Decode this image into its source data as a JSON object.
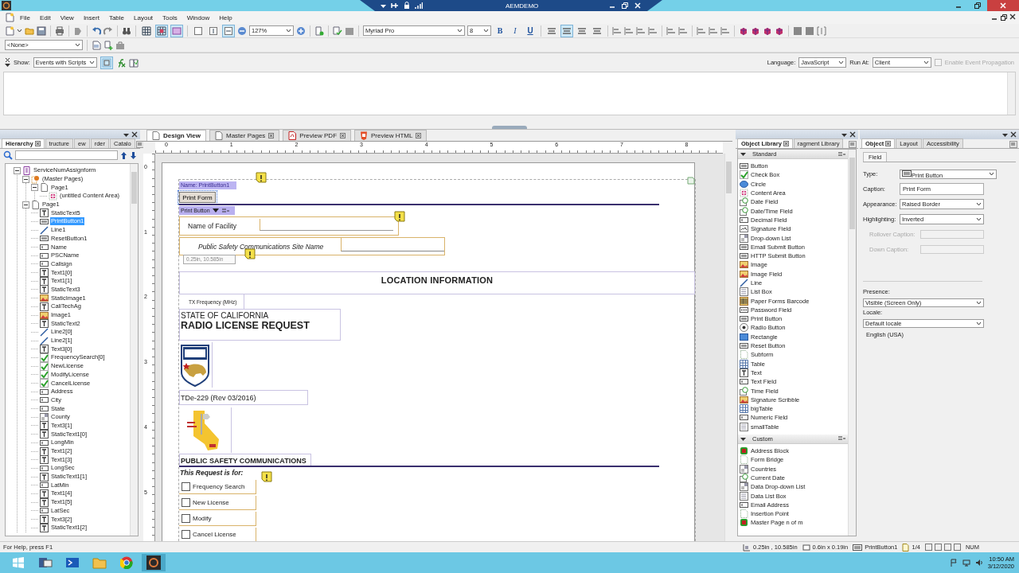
{
  "title_bar": {
    "session_title": "AEMDEMO"
  },
  "menu": [
    "File",
    "Edit",
    "View",
    "Insert",
    "Table",
    "Layout",
    "Tools",
    "Window",
    "Help"
  ],
  "toolbar": {
    "zoom": "127%",
    "font": "Myriad Pro",
    "font_size": "8",
    "view_toggles": [
      {
        "selected": false
      },
      {
        "selected": true
      },
      {
        "selected": true
      }
    ],
    "fit_toggles": [
      {
        "selected": false
      },
      {
        "selected": false
      },
      {
        "selected": true
      }
    ],
    "format": [
      {
        "label": "B",
        "selected": false
      },
      {
        "label": "I",
        "selected": false
      },
      {
        "label": "U",
        "selected": false
      }
    ],
    "align": [
      {
        "selected": false
      },
      {
        "selected": true
      },
      {
        "selected": false
      },
      {
        "selected": false
      }
    ]
  },
  "style_bar": {
    "style": "<None>"
  },
  "script_bar": {
    "show_label": "Show:",
    "show": "Events with Scripts",
    "language_label": "Language:",
    "language": "JavaScript",
    "run_at_label": "Run At:",
    "run_at": "Client",
    "propagation": {
      "label": "Enable Event Propagation",
      "checked": false,
      "disabled": true
    }
  },
  "hierarchy": {
    "tabs": [
      {
        "label": "Hierarchy",
        "selected": true
      },
      {
        "label": "tructure",
        "selected": false
      },
      {
        "label": "ew",
        "selected": false
      },
      {
        "label": "rder",
        "selected": false
      },
      {
        "label": "Catalo",
        "selected": false
      }
    ],
    "tree": [
      {
        "label": "ServiceNumAssignform",
        "kind": "form",
        "selected": false,
        "expanded": true,
        "children": [
          {
            "label": "(Master Pages)",
            "kind": "master",
            "selected": false,
            "expanded": true,
            "children": [
              {
                "label": "Page1",
                "kind": "page",
                "selected": false,
                "expanded": true,
                "children": [
                  {
                    "label": "(untitled Content Area)",
                    "kind": "area",
                    "selected": false
                  }
                ]
              }
            ]
          },
          {
            "label": "Page1",
            "kind": "page",
            "selected": false,
            "expanded": true,
            "children": [
              {
                "label": "StaticText5",
                "kind": "text",
                "selected": false
              },
              {
                "label": "PrintButton1",
                "kind": "button",
                "selected": true
              },
              {
                "label": "Line1",
                "kind": "line",
                "selected": false
              },
              {
                "label": "ResetButton1",
                "kind": "button",
                "selected": false
              },
              {
                "label": "Name",
                "kind": "field",
                "selected": false
              },
              {
                "label": "PSCName",
                "kind": "field",
                "selected": false
              },
              {
                "label": "Callsign",
                "kind": "field",
                "selected": false
              },
              {
                "label": "Text1[0]",
                "kind": "text",
                "selected": false
              },
              {
                "label": "Text1[1]",
                "kind": "text",
                "selected": false
              },
              {
                "label": "StaticText3",
                "kind": "text",
                "selected": false
              },
              {
                "label": "StaticImage1",
                "kind": "image",
                "selected": false
              },
              {
                "label": "CaliTechAg",
                "kind": "text",
                "selected": false
              },
              {
                "label": "Image1",
                "kind": "image",
                "selected": false
              },
              {
                "label": "StaticText2",
                "kind": "text",
                "selected": false
              },
              {
                "label": "Line2[0]",
                "kind": "line",
                "selected": false
              },
              {
                "label": "Line2[1]",
                "kind": "line",
                "selected": false
              },
              {
                "label": "Text3[0]",
                "kind": "text",
                "selected": false
              },
              {
                "label": "FrequencySearch[0]",
                "kind": "check",
                "selected": false
              },
              {
                "label": "NewLicense",
                "kind": "check",
                "selected": false
              },
              {
                "label": "ModifyLicense",
                "kind": "check",
                "selected": false
              },
              {
                "label": "CancelLicense",
                "kind": "check",
                "selected": false
              },
              {
                "label": "Address",
                "kind": "field",
                "selected": false
              },
              {
                "label": "City",
                "kind": "field",
                "selected": false
              },
              {
                "label": "State",
                "kind": "field",
                "selected": false
              },
              {
                "label": "County",
                "kind": "dropdown",
                "selected": false
              },
              {
                "label": "Text3[1]",
                "kind": "text",
                "selected": false
              },
              {
                "label": "StaticText1[0]",
                "kind": "text",
                "selected": false
              },
              {
                "label": "LongMin",
                "kind": "field",
                "selected": false
              },
              {
                "label": "Text1[2]",
                "kind": "text",
                "selected": false
              },
              {
                "label": "Text1[3]",
                "kind": "text",
                "selected": false
              },
              {
                "label": "LongSec",
                "kind": "field",
                "selected": false
              },
              {
                "label": "StaticText1[1]",
                "kind": "text",
                "selected": false
              },
              {
                "label": "LatMin",
                "kind": "field",
                "selected": false
              },
              {
                "label": "Text1[4]",
                "kind": "text",
                "selected": false
              },
              {
                "label": "Text1[5]",
                "kind": "text",
                "selected": false
              },
              {
                "label": "LatSec",
                "kind": "field",
                "selected": false
              },
              {
                "label": "Text3[2]",
                "kind": "text",
                "selected": false
              },
              {
                "label": "StaticText1[2]",
                "kind": "text",
                "selected": false
              }
            ]
          }
        ]
      }
    ]
  },
  "editor": {
    "tabs": [
      {
        "label": "Design View",
        "kind": "design",
        "selected": true,
        "closable": false
      },
      {
        "label": "Master Pages",
        "kind": "pages",
        "selected": false,
        "closable": true
      },
      {
        "label": "Preview PDF",
        "kind": "pdf",
        "selected": false,
        "closable": true
      },
      {
        "label": "Preview HTML",
        "kind": "html",
        "selected": false,
        "closable": true
      }
    ],
    "ruler_h": [
      "0",
      "1",
      "2",
      "3",
      "4",
      "5",
      "6",
      "7",
      "8"
    ],
    "ruler_v": [
      "0",
      "1",
      "2",
      "3",
      "4",
      "5"
    ]
  },
  "canvas": {
    "name_tag": "Name: PrintButton1",
    "print_button": "Print Form",
    "type_tag": "Print Button",
    "coord_tip": "0.25in, 10.585in",
    "facility_label": "Name of Facility",
    "site_label": "Public Safety Communications Site Name",
    "location_heading": "LOCATION INFORMATION",
    "tx_label": "TX Frequency (MHz)",
    "state_line": "STATE OF CALIFORNIA",
    "title": "RADIO LICENSE REQUEST",
    "form_number": "TDe-229 (Rev 03/2016)",
    "section_heading": "PUBLIC SAFETY COMMUNICATIONS",
    "request_label": "This Request is for:",
    "request_options": [
      {
        "label": "Frequency Search",
        "checked": false
      },
      {
        "label": "New License",
        "checked": false
      },
      {
        "label": "Modify",
        "checked": false
      },
      {
        "label": "Cancel License",
        "checked": false
      }
    ]
  },
  "library": {
    "tabs": [
      {
        "label": "Object Library",
        "selected": true
      },
      {
        "label": "ragment Library",
        "selected": false
      }
    ],
    "groups": [
      {
        "title": "Standard",
        "expanded": true,
        "items": [
          {
            "label": "Button",
            "kind": "button"
          },
          {
            "label": "Check Box",
            "kind": "check"
          },
          {
            "label": "Circle",
            "kind": "circle"
          },
          {
            "label": "Content Area",
            "kind": "area"
          },
          {
            "label": "Date Field",
            "kind": "date"
          },
          {
            "label": "Date/Time Field",
            "kind": "date"
          },
          {
            "label": "Decimal Field",
            "kind": "field"
          },
          {
            "label": "Signature Field",
            "kind": "signature"
          },
          {
            "label": "Drop-down List",
            "kind": "dropdown"
          },
          {
            "label": "Email Submit Button",
            "kind": "button"
          },
          {
            "label": "HTTP Submit Button",
            "kind": "button"
          },
          {
            "label": "Image",
            "kind": "image"
          },
          {
            "label": "Image Field",
            "kind": "image"
          },
          {
            "label": "Line",
            "kind": "line"
          },
          {
            "label": "List Box",
            "kind": "list"
          },
          {
            "label": "Paper Forms Barcode",
            "kind": "barcode"
          },
          {
            "label": "Password Field",
            "kind": "password"
          },
          {
            "label": "Print Button",
            "kind": "button"
          },
          {
            "label": "Radio Button",
            "kind": "radio"
          },
          {
            "label": "Rectangle",
            "kind": "rect"
          },
          {
            "label": "Reset Button",
            "kind": "button"
          },
          {
            "label": "Subform",
            "kind": "subform"
          },
          {
            "label": "Table",
            "kind": "table"
          },
          {
            "label": "Text",
            "kind": "text"
          },
          {
            "label": "Text Field",
            "kind": "field"
          },
          {
            "label": "Time Field",
            "kind": "date"
          },
          {
            "label": "Signature Scribble",
            "kind": "image"
          },
          {
            "label": "bigTable",
            "kind": "table"
          },
          {
            "label": "Numeric Field",
            "kind": "field"
          },
          {
            "label": "smallTable",
            "kind": "list"
          }
        ]
      },
      {
        "title": "Custom",
        "expanded": true,
        "items": [
          {
            "label": "Address Block",
            "kind": "block"
          },
          {
            "label": "Form Bridge",
            "kind": "subform"
          },
          {
            "label": "Countries",
            "kind": "dropdown"
          },
          {
            "label": "Current Date",
            "kind": "date"
          },
          {
            "label": "Data Drop-down List",
            "kind": "dropdown"
          },
          {
            "label": "Data List Box",
            "kind": "list"
          },
          {
            "label": "Email Address",
            "kind": "field"
          },
          {
            "label": "Insertion Point",
            "kind": "subform"
          },
          {
            "label": "Master Page n of m",
            "kind": "block"
          }
        ]
      }
    ]
  },
  "object": {
    "tabs": [
      {
        "label": "Object",
        "selected": true
      },
      {
        "label": "Layout",
        "selected": false
      },
      {
        "label": "Accessibility",
        "selected": false
      }
    ],
    "subtabs": [
      {
        "label": "Field",
        "selected": true
      }
    ],
    "type": {
      "label": "Type:",
      "value": "Print Button"
    },
    "caption": {
      "label": "Caption:",
      "value": "Print Form"
    },
    "appearance": {
      "label": "Appearance:",
      "value": "Raised Border"
    },
    "highlighting": {
      "label": "Highlighting:",
      "value": "Inverted"
    },
    "rollover": {
      "label": "Rollover Caption:",
      "disabled": true
    },
    "down": {
      "label": "Down Caption:",
      "disabled": true
    },
    "presence": {
      "label": "Presence:",
      "value": "Visible (Screen Only)"
    },
    "locale": {
      "label": "Locale:",
      "value": "Default locale",
      "note": "English (USA)"
    }
  },
  "status_bar": {
    "help": "For Help, press F1",
    "position": "0.25in , 10.585in",
    "size": "0.6in x 0.19in",
    "object": "PrintButton1",
    "page": "1/4",
    "num": "NUM"
  },
  "taskbar": {
    "time": "10:50 AM",
    "date": "3/12/2020"
  }
}
